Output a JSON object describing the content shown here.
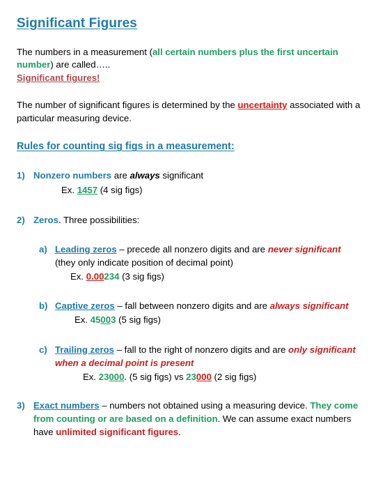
{
  "colors": {
    "title_blue": "#1F7BAA",
    "green": "#1F9C62",
    "brick_red": "#AC4A4C",
    "bright_red": "#E4140C",
    "dark_red": "#C51F1F",
    "body_black": "#000000",
    "background": "#FFFFFF"
  },
  "title": "Significant Figures",
  "intro": {
    "part1": "The numbers in a measurement (",
    "emphasis_green": "all certain numbers plus the first uncertain number",
    "part2": ") are called…..",
    "answer": "Significant figures!"
  },
  "uncertainty_para": {
    "part1": "The number of significant figures is determined by the ",
    "emphasis_red": "uncertainty",
    "part2": " associated with a particular measuring device."
  },
  "rules_heading": "Rules for counting sig figs in a measurement:",
  "rules": [
    {
      "marker": "1)",
      "term": "Nonzero numbers",
      "text_a": " are ",
      "emphasis": "always",
      "text_b": " significant",
      "example": {
        "label": "Ex.",
        "number_green_underline": "1457",
        "count": "(4 sig figs)"
      }
    },
    {
      "marker": "2)",
      "term": "Zeros.",
      "text_a": " Three possibilities:",
      "subrules": [
        {
          "marker": "a)",
          "term": "Leading zeros",
          "text_a": " – precede all nonzero digits and are ",
          "emphasis_red": "never significant",
          "text_b": " (they only indicate position of decimal point)",
          "example": {
            "label": "Ex.",
            "number_red_underline": "0.00",
            "number_green": "234",
            "count": "(3 sig figs)"
          }
        },
        {
          "marker": "b)",
          "term": "Captive zeros",
          "text_a": " – fall between nonzero digits and are ",
          "emphasis_red": "always significant",
          "text_b": "",
          "example": {
            "label": "Ex.",
            "number_green": "45",
            "number_green_underline": "00",
            "number_green_tail": "3",
            "count": "(5 sig figs)"
          }
        },
        {
          "marker": "c)",
          "term": "Trailing zeros",
          "text_a": " – fall to the right of nonzero digits and are ",
          "emphasis_red": "only significant when a decimal point is present",
          "text_b": "",
          "example": {
            "label": "Ex.",
            "first_green": "23",
            "first_green_underline": "000",
            "first_period": ".",
            "first_count": "(5 sig figs)",
            "vs": "vs",
            "second_green": "23",
            "second_red_underline": "000",
            "second_count": "(2 sig figs)"
          }
        }
      ]
    },
    {
      "marker": "3)",
      "term": "Exact numbers",
      "text_a": " – numbers not obtained using a measuring device. ",
      "emphasis_green": "They come from counting or are based on a definition",
      "text_b": ". We can assume exact numbers have ",
      "emphasis_red": "unlimited significant figures",
      "text_c": "."
    }
  ]
}
